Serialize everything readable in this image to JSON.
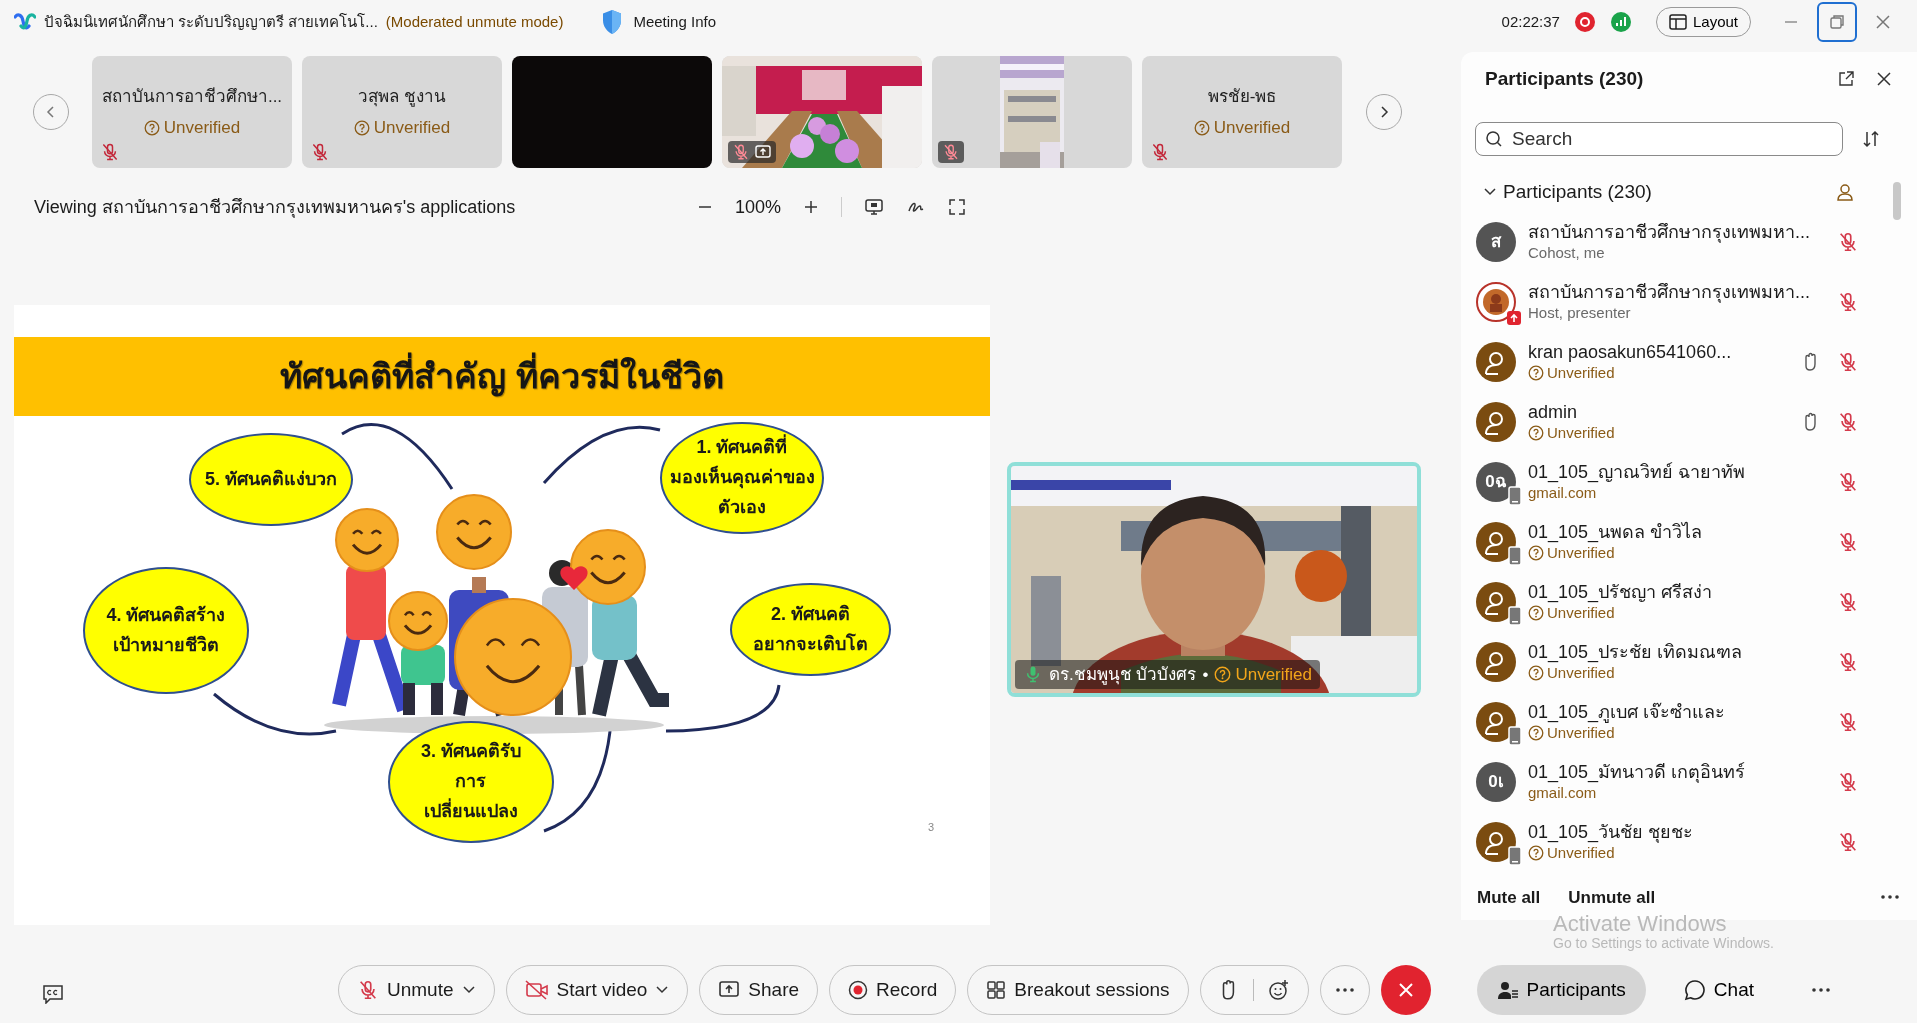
{
  "window": {
    "title": "ปัจฉิมนิเทศนักศึกษา ระดับปริญญาตรี สายเทคโนโ...",
    "mode": "(Moderated unmute mode)",
    "meeting_info": "Meeting Info",
    "time": "02:22:37",
    "recording": true,
    "layout_button": "Layout"
  },
  "thumbnails": [
    {
      "kind": "name",
      "name": "สถาบันการอาชีวศึกษา...",
      "status": "Unverified",
      "muted": true
    },
    {
      "kind": "name",
      "name": "วสุพล ชูงาน",
      "status": "Unverified",
      "muted": true
    },
    {
      "kind": "blank"
    },
    {
      "kind": "video",
      "muted": true,
      "sharing": true
    },
    {
      "kind": "video",
      "muted": true,
      "sharing": false
    },
    {
      "kind": "name",
      "name": "พรชัย-พธ",
      "status": "Unverified",
      "muted": true
    }
  ],
  "viewing": "Viewing สถาบันการอาชีวศึกษากรุงเทพมหานคร's applications",
  "zoom": "100%",
  "slide": {
    "title": "ทัศนคติที่สำคัญ ที่ควรมีในชีวิต",
    "bubbles": [
      {
        "text": "5. ทัศนคติแง่บวก"
      },
      {
        "text": "1. ทัศนคติที่\nมองเห็นคุณค่าของ\nตัวเอง"
      },
      {
        "text": "4. ทัศนคติสร้าง\nเป้าหมายชีวิต"
      },
      {
        "text": "2. ทัศนคติ\nอยากจะเติบโต"
      },
      {
        "text": "3. ทัศนคติรับ\nการ\nเปลี่ยนแปลง"
      }
    ],
    "page": "3"
  },
  "video_tile": {
    "name": "ดร.ชมพูนุช บัวบังศร",
    "separator": "•",
    "status": "Unverified",
    "muted": false
  },
  "participants_panel": {
    "title": "Participants (230)",
    "search": {
      "placeholder": "Search"
    },
    "section": {
      "label": "Participants (230)",
      "expanded": true
    },
    "rows": [
      {
        "avatar": {
          "kind": "initials",
          "text": "ส"
        },
        "name": "สถาบันการอาชีวศึกษากรุงเทพมหา...",
        "subtitle": {
          "kind": "role",
          "text": "Cohost, me"
        },
        "presenting": false,
        "mobile": false,
        "hand": false,
        "muted": true
      },
      {
        "avatar": {
          "kind": "logo"
        },
        "name": "สถาบันการอาชีวศึกษากรุงเทพมหา...",
        "subtitle": {
          "kind": "role",
          "text": "Host, presenter"
        },
        "presenting": true,
        "mobile": false,
        "hand": false,
        "muted": true
      },
      {
        "avatar": {
          "kind": "guest"
        },
        "name": "kran paosakun6541060...",
        "subtitle": {
          "kind": "unverified",
          "text": "Unverified"
        },
        "presenting": false,
        "mobile": false,
        "hand": true,
        "muted": true
      },
      {
        "avatar": {
          "kind": "guest"
        },
        "name": "admin",
        "subtitle": {
          "kind": "unverified",
          "text": "Unverified"
        },
        "presenting": false,
        "mobile": false,
        "hand": true,
        "muted": true
      },
      {
        "avatar": {
          "kind": "initials",
          "text": "0ฉ"
        },
        "name": "01_105_ญาณวิทย์ ฉายาทัพ",
        "subtitle": {
          "kind": "email",
          "text": "gmail.com"
        },
        "presenting": false,
        "mobile": true,
        "hand": false,
        "muted": true
      },
      {
        "avatar": {
          "kind": "guest"
        },
        "name": "01_105_นพดล ขำวิไล",
        "subtitle": {
          "kind": "unverified",
          "text": "Unverified"
        },
        "presenting": false,
        "mobile": true,
        "hand": false,
        "muted": true
      },
      {
        "avatar": {
          "kind": "guest"
        },
        "name": "01_105_ปรัชญา ศรีสง่า",
        "subtitle": {
          "kind": "unverified",
          "text": "Unverified"
        },
        "presenting": false,
        "mobile": true,
        "hand": false,
        "muted": true
      },
      {
        "avatar": {
          "kind": "guest"
        },
        "name": "01_105_ประชัย เทิดมณฑล",
        "subtitle": {
          "kind": "unverified",
          "text": "Unverified"
        },
        "presenting": false,
        "mobile": false,
        "hand": false,
        "muted": true
      },
      {
        "avatar": {
          "kind": "guest"
        },
        "name": "01_105_ภูเบศ เจ๊ะซำและ",
        "subtitle": {
          "kind": "unverified",
          "text": "Unverified"
        },
        "presenting": false,
        "mobile": true,
        "hand": false,
        "muted": true
      },
      {
        "avatar": {
          "kind": "initials",
          "text": "0เ"
        },
        "name": "01_105_มัทนาวดี เกตุอินทร์",
        "subtitle": {
          "kind": "email",
          "text": "gmail.com"
        },
        "presenting": false,
        "mobile": false,
        "hand": false,
        "muted": true
      },
      {
        "avatar": {
          "kind": "guest"
        },
        "name": "01_105_วันชัย ชุยชะ",
        "subtitle": {
          "kind": "unverified",
          "text": "Unverified"
        },
        "presenting": false,
        "mobile": true,
        "hand": false,
        "muted": true
      }
    ],
    "mute_all": "Mute all",
    "unmute_all": "Unmute all"
  },
  "toolbar": {
    "center": [
      {
        "kind": "unmute",
        "label": "Unmute",
        "menu": true
      },
      {
        "kind": "video",
        "label": "Start video",
        "menu": true
      },
      {
        "kind": "share",
        "label": "Share",
        "menu": false
      },
      {
        "kind": "record",
        "label": "Record",
        "menu": false
      },
      {
        "kind": "breakout",
        "label": "Breakout sessions",
        "menu": false
      },
      {
        "kind": "reactions"
      },
      {
        "kind": "more"
      },
      {
        "kind": "end"
      }
    ],
    "right": [
      {
        "kind": "participants",
        "label": "Participants",
        "selected": true
      },
      {
        "kind": "chat",
        "label": "Chat",
        "selected": false
      },
      {
        "kind": "more"
      }
    ]
  },
  "os_notice": {
    "title": "Activate Windows",
    "text": "Go to Settings to activate Windows."
  }
}
